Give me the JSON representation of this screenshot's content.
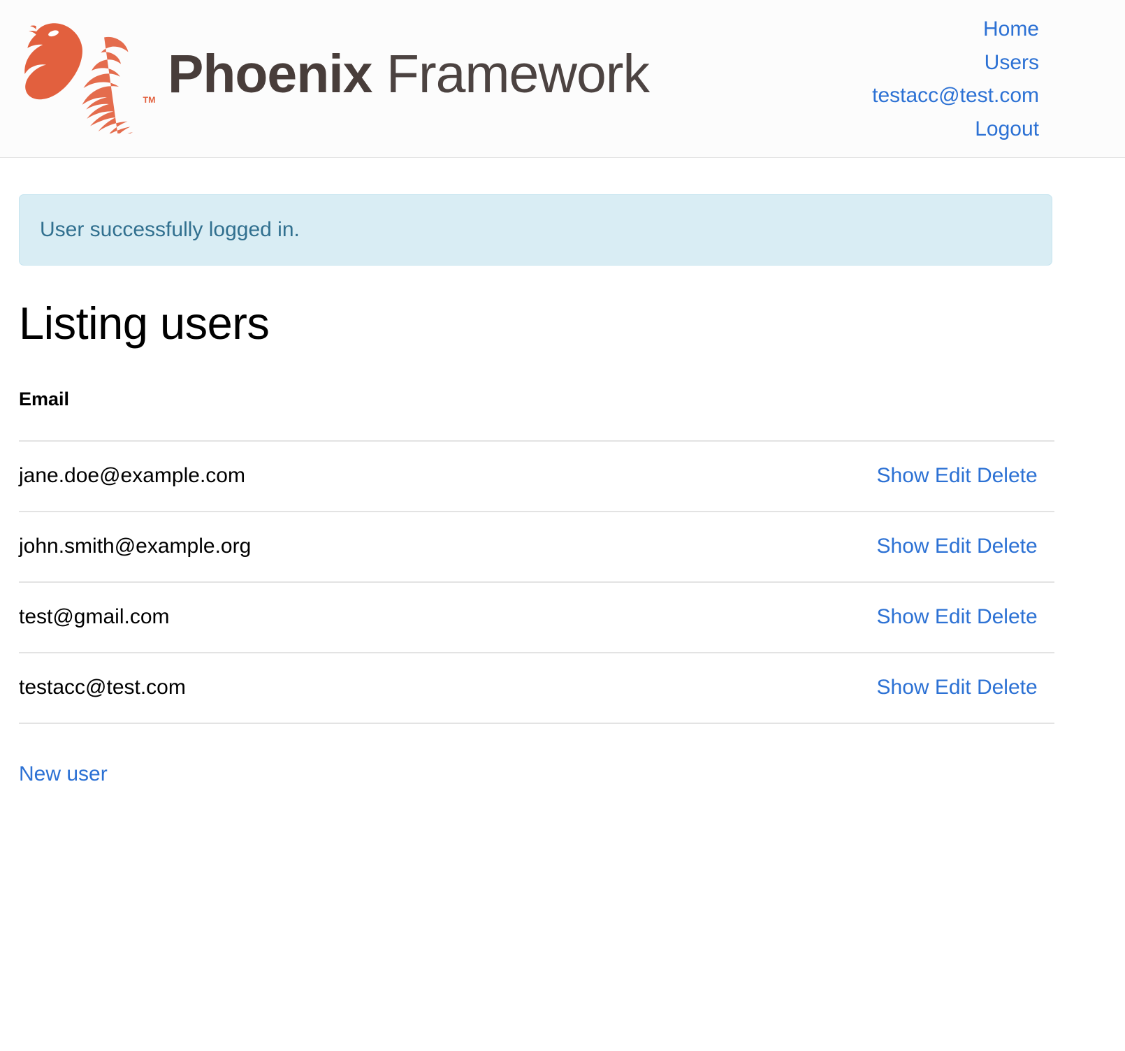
{
  "header": {
    "logo": {
      "icon": "phoenix-bird-logo",
      "brand_bold": "Phoenix",
      "brand_light": " Framework",
      "color": "#e2603e"
    },
    "nav": [
      {
        "label": "Home",
        "name": "nav-link-home"
      },
      {
        "label": "Users",
        "name": "nav-link-users"
      },
      {
        "label": "testacc@test.com",
        "name": "nav-link-account-email"
      },
      {
        "label": "Logout",
        "name": "nav-link-logout"
      }
    ]
  },
  "flash": {
    "message": "User successfully logged in.",
    "type": "info",
    "background": "#d9edf4",
    "border": "#c6e4ef",
    "text_color": "#31708f"
  },
  "main": {
    "page_title": "Listing users",
    "table": {
      "columns": [
        "Email",
        ""
      ],
      "rows": [
        {
          "email": "jane.doe@example.com"
        },
        {
          "email": "john.smith@example.org"
        },
        {
          "email": "test@gmail.com"
        },
        {
          "email": "testacc@test.com"
        }
      ],
      "actions": {
        "show": "Show",
        "edit": "Edit",
        "delete": "Delete"
      }
    },
    "new_user_link": "New user"
  },
  "colors": {
    "link": "#2c71d4",
    "accent_orange": "#e2603e",
    "rule": "#e3e3e3",
    "header_bg": "#fcfcfc"
  }
}
